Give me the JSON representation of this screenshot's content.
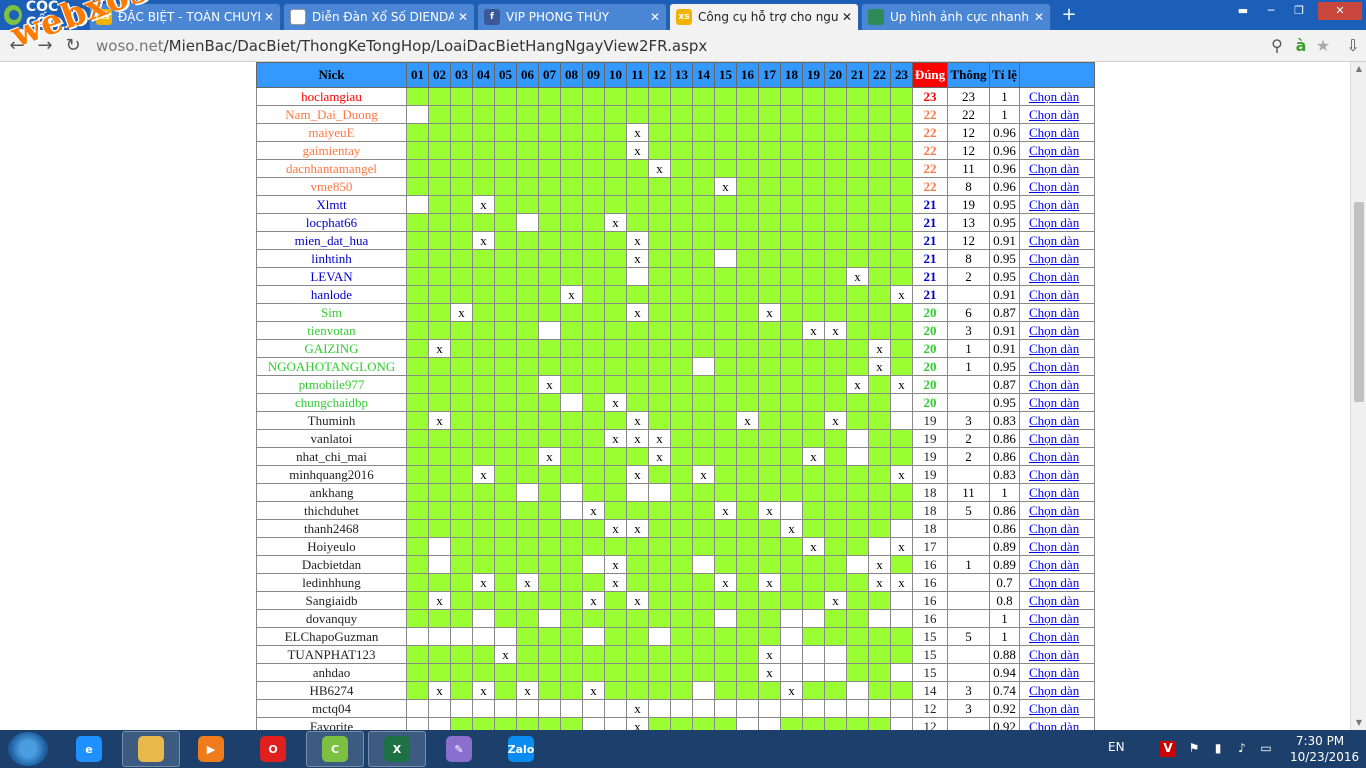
{
  "browser": {
    "brand": "CỐC CỐC",
    "tabs": [
      {
        "title": "ĐẶC BIỆT - TOÀN CHUYÊN",
        "icon": "xoso-icon",
        "color": "#f0b400"
      },
      {
        "title": "Diễn Đàn Xổ Số DIENDAN",
        "icon": "document-icon",
        "color": "#ffffff"
      },
      {
        "title": "VIP PHONG THỦY",
        "icon": "facebook-icon",
        "color": "#3b5998"
      },
      {
        "title": "Công cụ hỗ trợ cho người",
        "icon": "xoso-icon",
        "color": "#f0b400"
      },
      {
        "title": "Up hình ảnh cực nhanh - U",
        "icon": "image-icon",
        "color": "#2e8b57"
      }
    ],
    "url_prefix": "w",
    "url_host": "oso.net",
    "url_path": "/MienBac/DacBiet/ThongKeTongHop/LoaiDacBietHangNgayView2FR.aspx",
    "watermark": "webxoso.net"
  },
  "table": {
    "headers": {
      "nick": "Nick",
      "days": [
        "01",
        "02",
        "03",
        "04",
        "05",
        "06",
        "07",
        "08",
        "09",
        "10",
        "11",
        "12",
        "13",
        "14",
        "15",
        "16",
        "17",
        "18",
        "19",
        "20",
        "21",
        "22",
        "23"
      ],
      "dung": "Đúng",
      "thong": "Thông",
      "tile": "Tỉ lệ"
    },
    "link_label": "Chọn dàn",
    "rows": [
      {
        "nick": "hoclamgiau",
        "color": "red",
        "cells": "GGGGGGGGGGGGGGGGGGGGGGG",
        "dung": "23",
        "thong": "23",
        "tile": "1"
      },
      {
        "nick": "Nam_Dai_Duong",
        "color": "orange",
        "cells": "WGGGGGGGGGGGGGGGGGGGGGG",
        "dung": "22",
        "thong": "22",
        "tile": "1"
      },
      {
        "nick": "maiyeuE",
        "color": "orange",
        "cells": "GGGGGGGGGGXGGGGGGGGGGGG",
        "dung": "22",
        "thong": "12",
        "tile": "0.96"
      },
      {
        "nick": "gaimientay",
        "color": "orange",
        "cells": "GGGGGGGGGGXGGGGGGGGGGGG",
        "dung": "22",
        "thong": "12",
        "tile": "0.96"
      },
      {
        "nick": "dacnhantamangel",
        "color": "orange",
        "cells": "GGGGGGGGGGGXGGGGGGGGGGG",
        "dung": "22",
        "thong": "11",
        "tile": "0.96"
      },
      {
        "nick": "vme850",
        "color": "orange",
        "cells": "GGGGGGGGGGGGGGXGGGGGGGG",
        "dung": "22",
        "thong": "8",
        "tile": "0.96"
      },
      {
        "nick": "Xlmtt",
        "color": "blue",
        "cells": "WGGXGGGGGGGGGGGGGGGGGGG",
        "dung": "21",
        "thong": "19",
        "tile": "0.95"
      },
      {
        "nick": "locphat66",
        "color": "blue",
        "cells": "GGGGGWGGGXGGGGGGGGGGGGG",
        "dung": "21",
        "thong": "13",
        "tile": "0.95"
      },
      {
        "nick": "mien_dat_hua",
        "color": "blue",
        "cells": "GGGXGGGGGGXGGGGGGGGGGGG",
        "dung": "21",
        "thong": "12",
        "tile": "0.91"
      },
      {
        "nick": "linhtinh",
        "color": "blue",
        "cells": "GGGGGGGGGGXGGGWGGGGGGGG",
        "dung": "21",
        "thong": "8",
        "tile": "0.95"
      },
      {
        "nick": "LEVAN",
        "color": "blue",
        "cells": "GGGGGGGGGGWGGGGGGGGGXGG",
        "dung": "21",
        "thong": "2",
        "tile": "0.95"
      },
      {
        "nick": "hanlode",
        "color": "blue",
        "cells": "GGGGGGGXGGGGGGGGGGGGGGX",
        "dung": "21",
        "thong": "",
        "tile": "0.91"
      },
      {
        "nick": "Sim",
        "color": "green",
        "cells": "GGXGGGGGGGXGGGGGXGGGGGG",
        "dung": "20",
        "thong": "6",
        "tile": "0.87"
      },
      {
        "nick": "tienvotan",
        "color": "green",
        "cells": "GGGGGGWGGGGGGGGGGGXXGGG",
        "dung": "20",
        "thong": "3",
        "tile": "0.91"
      },
      {
        "nick": "GAIZING",
        "color": "green",
        "cells": "GXGGGGGGGGGGGGGGGGGGGXG",
        "dung": "20",
        "thong": "1",
        "tile": "0.91"
      },
      {
        "nick": "NGOAHOTANGLONG",
        "color": "green",
        "cells": "GGGGGGGGGGGGGWGGGGGGGXG",
        "dung": "20",
        "thong": "1",
        "tile": "0.95"
      },
      {
        "nick": "ptmobile977",
        "color": "green",
        "cells": "GGGGGGXGGGGGGGGGGGGGXGX",
        "dung": "20",
        "thong": "",
        "tile": "0.87"
      },
      {
        "nick": "chungchaidbp",
        "color": "green",
        "cells": "GGGGGGGWGXGGGGGGGGGGGGW",
        "dung": "20",
        "thong": "",
        "tile": "0.95"
      },
      {
        "nick": "Thuminh",
        "color": "black",
        "cells": "GXGGGGGGGGXGGGGXGGGXGGW",
        "dung": "19",
        "thong": "3",
        "tile": "0.83"
      },
      {
        "nick": "vanlatoi",
        "color": "black",
        "cells": "GGGGGGGGGXXXGGGGGGGGWGG",
        "dung": "19",
        "thong": "2",
        "tile": "0.86"
      },
      {
        "nick": "nhat_chi_mai",
        "color": "black",
        "cells": "GGGGGGXGGGGXGGGGGGXGWGG",
        "dung": "19",
        "thong": "2",
        "tile": "0.86"
      },
      {
        "nick": "minhquang2016",
        "color": "black",
        "cells": "GGGXGGGGGGXGGXGGGGGGGGX",
        "dung": "19",
        "thong": "",
        "tile": "0.83"
      },
      {
        "nick": "ankhang",
        "color": "black",
        "cells": "GGGGGWGWGGWWGGGGGGGGGGG",
        "dung": "18",
        "thong": "11",
        "tile": "1"
      },
      {
        "nick": "thichduhet",
        "color": "black",
        "cells": "GGGGGGGWXGGGGGXGXWGGGGG",
        "dung": "18",
        "thong": "5",
        "tile": "0.86"
      },
      {
        "nick": "thanh2468",
        "color": "black",
        "cells": "GGGGGGGGGXXGGGGGGXGGGGW",
        "dung": "18",
        "thong": "",
        "tile": "0.86"
      },
      {
        "nick": "Hoiyeulo",
        "color": "black",
        "cells": "GWGGGGGGGGGGGGGGGGXGGWX",
        "dung": "17",
        "thong": "",
        "tile": "0.89"
      },
      {
        "nick": "Dacbietdan",
        "color": "black",
        "cells": "GWGGGGGGWXGGGWGGGGGGWXG",
        "dung": "16",
        "thong": "1",
        "tile": "0.89"
      },
      {
        "nick": "ledinhhung",
        "color": "black",
        "cells": "GGGXGXGGGXGGGGXGXGGGGXX",
        "dung": "16",
        "thong": "",
        "tile": "0.7"
      },
      {
        "nick": "Sangiaidb",
        "color": "black",
        "cells": "GXGGGGGGXGXGGGGGGGGXGGW",
        "dung": "16",
        "thong": "",
        "tile": "0.8"
      },
      {
        "nick": "dovanquy",
        "color": "black",
        "cells": "GGGWGGWGGGGGGGWGGWWGGWW",
        "dung": "16",
        "thong": "",
        "tile": "1"
      },
      {
        "nick": "ELChapoGuzman",
        "color": "black",
        "cells": "WWWWWGGGWGGWGGGGGWGGGGG",
        "dung": "15",
        "thong": "5",
        "tile": "1"
      },
      {
        "nick": "TUANPHAT123",
        "color": "black",
        "cells": "GGGGXGGGGGGGGGGGXWWWGGG",
        "dung": "15",
        "thong": "",
        "tile": "0.88"
      },
      {
        "nick": "anhdao",
        "color": "black",
        "cells": "GGGGGGGGGGGGGGGGXWWWGGW",
        "dung": "15",
        "thong": "",
        "tile": "0.94"
      },
      {
        "nick": "HB6274",
        "color": "black",
        "cells": "GXGXGXGGXGGGGWGGGXGGWGG",
        "dung": "14",
        "thong": "3",
        "tile": "0.74"
      },
      {
        "nick": "mctq04",
        "color": "black",
        "cells": "WWWWWWWWWWXWWWWWWWWWWWW",
        "dung": "12",
        "thong": "3",
        "tile": "0.92"
      },
      {
        "nick": "Favorite",
        "color": "black",
        "cells": "WWGGGGGGWWXGGGGWWGGGGGW",
        "dung": "12",
        "thong": "",
        "tile": "0.92"
      }
    ]
  },
  "taskbar": {
    "apps": [
      {
        "name": "internet-explorer-icon",
        "label": "e",
        "color": "#1e90ff"
      },
      {
        "name": "file-explorer-icon",
        "label": "",
        "color": "#e8b84a"
      },
      {
        "name": "media-player-icon",
        "label": "▶",
        "color": "#f07b1a"
      },
      {
        "name": "opera-icon",
        "label": "O",
        "color": "#e0201e"
      },
      {
        "name": "coccoc-icon",
        "label": "C",
        "color": "#7cc142"
      },
      {
        "name": "excel-icon",
        "label": "X",
        "color": "#1e7145"
      },
      {
        "name": "paint-icon",
        "label": "✎",
        "color": "#8a6fcf"
      },
      {
        "name": "zalo-icon",
        "label": "Zalo",
        "color": "#0a8cf0"
      }
    ],
    "lang": "EN",
    "time": "7:30 PM",
    "date": "10/23/2016"
  }
}
